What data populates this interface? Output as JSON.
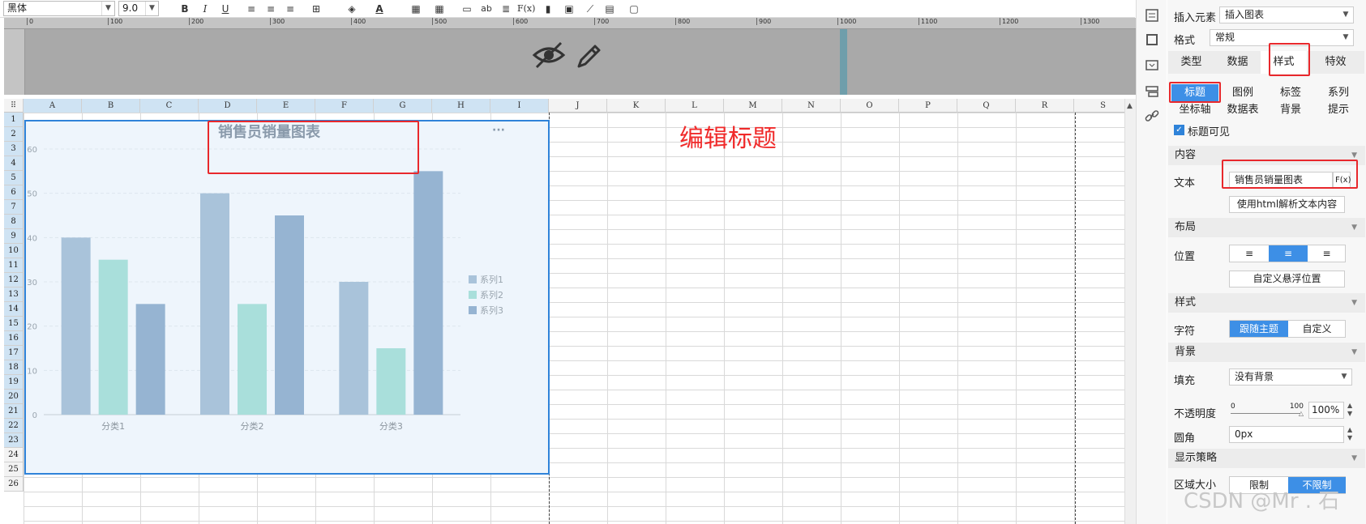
{
  "toolbar": {
    "font": "黑体",
    "size": "9.0",
    "bold": "B",
    "italic": "I",
    "underline": "U",
    "text_ab": "ab",
    "formula": "F(x)"
  },
  "ruler": {
    "ticks": [
      "0",
      "100",
      "200",
      "300",
      "400",
      "500",
      "600",
      "700",
      "800",
      "900",
      "1000",
      "1100",
      "1200",
      "1300"
    ]
  },
  "sheet": {
    "columns": [
      "A",
      "B",
      "C",
      "D",
      "E",
      "F",
      "G",
      "H",
      "I",
      "J",
      "K",
      "L",
      "M",
      "N",
      "O",
      "P",
      "Q",
      "R",
      "S"
    ],
    "rows": [
      "1",
      "2",
      "3",
      "4",
      "5",
      "6",
      "7",
      "8",
      "9",
      "10",
      "11",
      "12",
      "13",
      "14",
      "15",
      "16",
      "17",
      "18",
      "19",
      "20",
      "21",
      "22",
      "23",
      "24",
      "25",
      "26"
    ]
  },
  "annotation": "编辑标题",
  "chart_data": {
    "type": "bar",
    "title": "销售员销量图表",
    "categories": [
      "分类1",
      "分类2",
      "分类3"
    ],
    "series": [
      {
        "name": "系列1",
        "values": [
          40,
          50,
          30
        ],
        "color": "#a9c3da"
      },
      {
        "name": "系列2",
        "values": [
          35,
          25,
          15
        ],
        "color": "#a9dfdb"
      },
      {
        "name": "系列3",
        "values": [
          25,
          45,
          55
        ],
        "color": "#96b4d2"
      }
    ],
    "ylim": [
      0,
      60
    ],
    "yticks": [
      "0",
      "10",
      "20",
      "30",
      "40",
      "50",
      "60"
    ],
    "legend": "right",
    "grid": true,
    "more": "···"
  },
  "panel": {
    "insert_label": "插入元素",
    "insert_value": "插入图表",
    "format_label": "格式",
    "format_value": "常规",
    "tabs": [
      "类型",
      "数据",
      "样式",
      "特效"
    ],
    "subtabs": [
      "标题",
      "图例",
      "标签",
      "系列",
      "坐标轴",
      "数据表",
      "背景",
      "提示"
    ],
    "title_visible": "标题可见",
    "sec_content": "内容",
    "text_label": "文本",
    "text_value": "销售员销量图表",
    "fx": "F(x)",
    "html_btn": "使用html解析文本内容",
    "sec_layout": "布局",
    "pos_label": "位置",
    "custom_pos": "自定义悬浮位置",
    "sec_style": "样式",
    "char_label": "字符",
    "follow_theme": "跟随主题",
    "custom": "自定义",
    "sec_bg": "背景",
    "fill_label": "填充",
    "fill_value": "没有背景",
    "opacity_label": "不透明度",
    "opacity_min": "0",
    "opacity_max": "100",
    "opacity_value": "100%",
    "radius_label": "圆角",
    "radius_value": "0px",
    "sec_display": "显示策略",
    "area_label": "区域大小",
    "limit": "限制",
    "nolimit": "不限制"
  },
  "watermark": "CSDN @Mr . 石"
}
